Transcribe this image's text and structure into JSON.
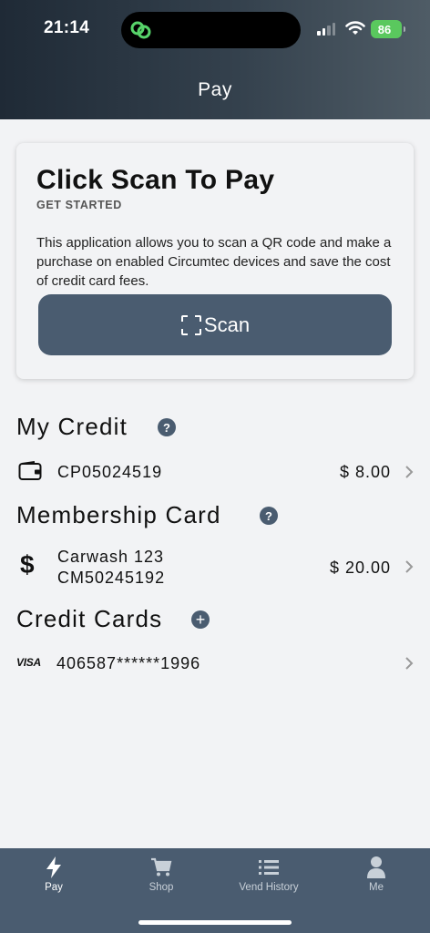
{
  "status_bar": {
    "time": "21:14",
    "battery": "86"
  },
  "header": {
    "title": "Pay"
  },
  "scan_card": {
    "title": "Click Scan To Pay",
    "subtitle": "GET STARTED",
    "description": "This application allows you to scan a QR code and make a purchase on enabled Circumtec devices and save the cost of credit card fees.",
    "button_label": "Scan"
  },
  "my_credit": {
    "title": "My Credit",
    "items": [
      {
        "icon": "wallet-icon",
        "id": "CP05024519",
        "amount": "$ 8.00"
      }
    ]
  },
  "membership": {
    "title": "Membership Card",
    "items": [
      {
        "icon": "dollar-icon",
        "name": "Carwash 123",
        "id": "CM50245192",
        "amount": "$ 20.00"
      }
    ]
  },
  "credit_cards": {
    "title": "Credit Cards",
    "items": [
      {
        "brand": "VISA",
        "number": "406587******1996"
      }
    ]
  },
  "tabs": [
    {
      "label": "Pay",
      "icon": "bolt-icon",
      "active": true
    },
    {
      "label": "Shop",
      "icon": "cart-icon",
      "active": false
    },
    {
      "label": "Vend History",
      "icon": "list-icon",
      "active": false
    },
    {
      "label": "Me",
      "icon": "person-icon",
      "active": false
    }
  ],
  "colors": {
    "accent": "#4a5c70",
    "header_dark": "#1f2a36",
    "battery": "#5ac85e"
  }
}
